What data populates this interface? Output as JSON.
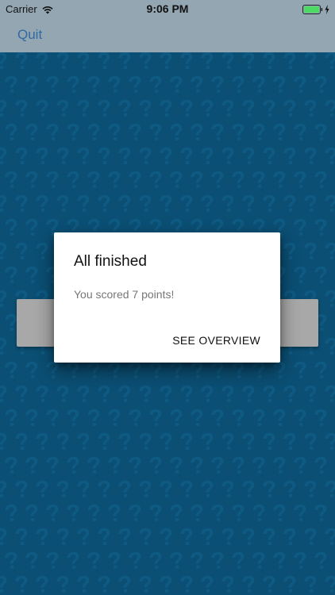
{
  "status_bar": {
    "carrier": "Carrier",
    "time": "9:06 PM",
    "icons": [
      "wifi-icon",
      "battery-icon",
      "charging-icon"
    ],
    "battery_color": "#4cd964"
  },
  "nav_bar": {
    "quit_label": "Quit"
  },
  "dialog": {
    "title": "All finished",
    "message": "You scored 7 points!",
    "action_label": "SEE OVERVIEW"
  },
  "colors": {
    "background": "#0b4f74",
    "pattern": "#0f5a83",
    "nav_bar": "#94a6b2",
    "quit_tint": "#2f6aa1"
  }
}
